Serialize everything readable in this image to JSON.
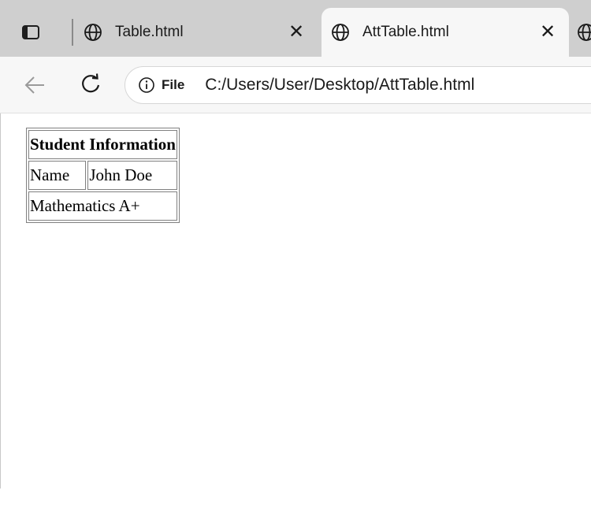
{
  "tabs": [
    {
      "title": "Table.html",
      "active": false,
      "icon": "globe-icon"
    },
    {
      "title": "AttTable.html",
      "active": true,
      "icon": "globe-icon"
    }
  ],
  "toolbar": {
    "back_icon": "back-arrow-icon",
    "refresh_icon": "refresh-icon",
    "site_info_label": "File",
    "url": "C:/Users/User/Desktop/AttTable.html"
  },
  "page": {
    "table": {
      "header": "Student Information",
      "row1": {
        "label": "Name",
        "value": "John Doe"
      },
      "row2": {
        "text": "Mathematics A+"
      }
    }
  },
  "colors": {
    "tabstrip": "#cfcfcf",
    "active_tab": "#f7f7f7",
    "toolbar": "#f7f7f7",
    "page_bg": "#ffffff"
  }
}
